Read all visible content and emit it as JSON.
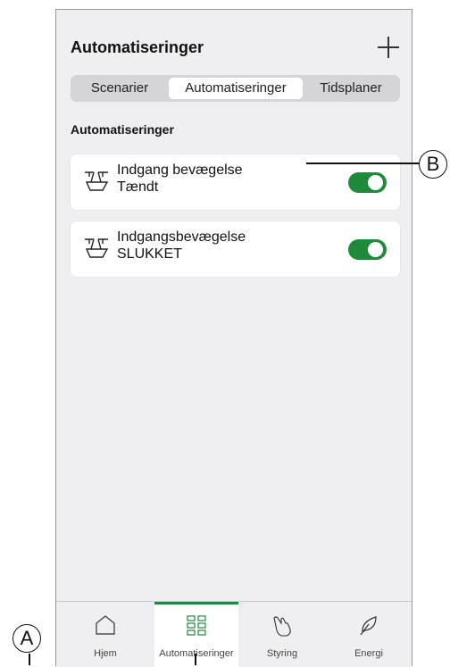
{
  "header": {
    "title": "Automatiseringer",
    "add_icon": "plus-icon"
  },
  "segments": [
    {
      "label": "Scenarier",
      "active": false
    },
    {
      "label": "Automatiseringer",
      "active": true
    },
    {
      "label": "Tidsplaner",
      "active": false
    }
  ],
  "section_title": "Automatiseringer",
  "automations": [
    {
      "line1": "Indgang bevægelse",
      "line2": "Tændt",
      "icon": "motion-sensor-icon",
      "enabled": true
    },
    {
      "line1": "Indgangsbevægelse",
      "line2": "SLUKKET",
      "icon": "motion-sensor-icon",
      "enabled": true
    }
  ],
  "tabs": [
    {
      "label": "Hjem",
      "icon": "home-icon",
      "active": false
    },
    {
      "label": "Automatiseringer",
      "icon": "grid-icon",
      "active": true
    },
    {
      "label": "Styring",
      "icon": "hand-icon",
      "active": false
    },
    {
      "label": "Energi",
      "icon": "leaf-icon",
      "active": false
    }
  ],
  "callouts": {
    "a": "A",
    "b": "B"
  },
  "colors": {
    "accent": "#1f8a3a",
    "background": "#efeff1"
  }
}
